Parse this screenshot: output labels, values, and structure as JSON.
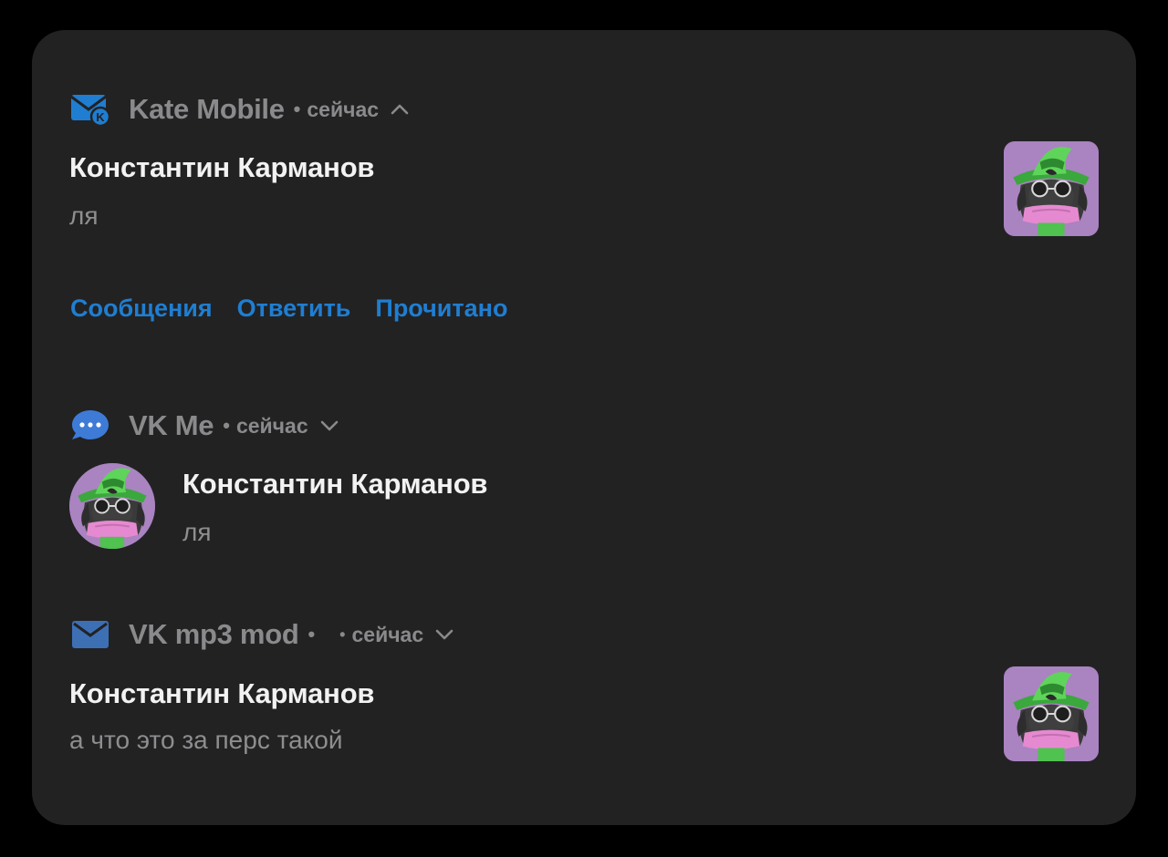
{
  "colors": {
    "background": "#000000",
    "panel": "#222223",
    "accent": "#1f7ed1",
    "muted_text": "#8a8a8c",
    "primary_text": "#f2f2f2"
  },
  "notifications": [
    {
      "app_name": "Kate Mobile",
      "app_icon": "kate-mobile-mail-icon",
      "separator": "•",
      "time": "сейчас",
      "expand_state": "chevron-up-icon",
      "sender": "Константин Карманов",
      "message": "ля",
      "image": "character-thumbnail",
      "actions": [
        "Сообщения",
        "Ответить",
        "Прочитано"
      ]
    },
    {
      "app_name": "VK Me",
      "app_icon": "chat-bubble-dots-icon",
      "separator": "•",
      "time": "сейчас",
      "expand_state": "chevron-down-icon",
      "sender": "Константин Карманов",
      "message": "ля",
      "image": "character-avatar"
    },
    {
      "app_name": "VK mp3 mod",
      "app_icon": "envelope-icon",
      "separator": "•",
      "separator_2": "•",
      "time": "сейчас",
      "expand_state": "chevron-down-icon",
      "sender": "Константин Карманов",
      "message": "а что это за перс такой",
      "image": "character-thumbnail"
    }
  ]
}
